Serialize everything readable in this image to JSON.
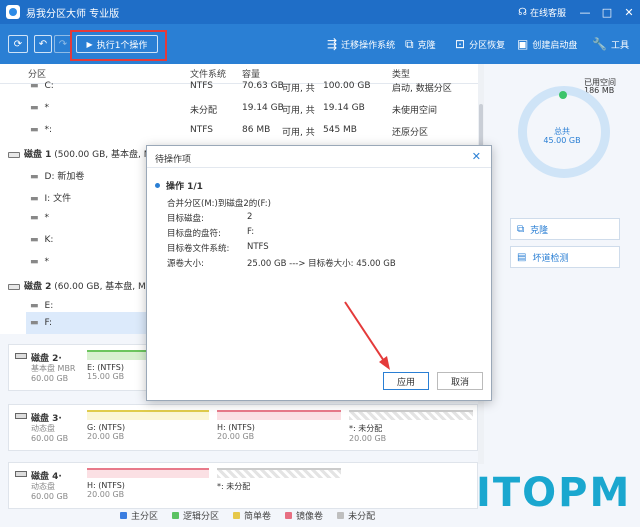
{
  "app": {
    "title": "易我分区大师 专业版"
  },
  "titlebar": {
    "service": "在线客服",
    "minimize": "—",
    "maximize": "□",
    "close": "✕"
  },
  "toolbar": {
    "execute_label": "执行1个操作",
    "items": [
      "迁移操作系统",
      "克隆",
      "分区恢复",
      "创建启动盘",
      "工具"
    ]
  },
  "list": {
    "headers": [
      "分区",
      "文件系统",
      "容量",
      "类型"
    ],
    "rows": [
      {
        "name": "C:",
        "fs": "NTFS",
        "used": "70.63 GB",
        "avail": "可用, 共",
        "total": "100.00 GB",
        "type": "启动, 数据分区"
      },
      {
        "name": "*",
        "fs": "未分配",
        "used": "19.14 GB",
        "avail": "可用, 共",
        "total": "19.14 GB",
        "type": "未使用空间"
      },
      {
        "name": "*:",
        "fs": "NTFS",
        "used": "86 MB",
        "avail": "可用, 共",
        "total": "545 MB",
        "type": "还原分区"
      },
      {
        "disk": "磁盘 1",
        "desc": "(500.00 GB, 基本盘, MBR..."
      },
      {
        "name": "D: 新加卷"
      },
      {
        "name": "I: 文件"
      },
      {
        "name": "*"
      },
      {
        "name": "K:"
      },
      {
        "name": "*"
      },
      {
        "disk": "磁盘 2",
        "desc": "(60.00 GB, 基本盘, MBR..."
      },
      {
        "name": "E:"
      },
      {
        "name": "F:"
      }
    ]
  },
  "maps": {
    "cards": [
      {
        "title": "磁盘 2·",
        "sub": "基本盘 MBR",
        "size": "60.00 GB",
        "segs": [
          {
            "t1": "E: (NTFS)",
            "t2": "15.00 GB"
          }
        ]
      },
      {
        "title": "磁盘 3·",
        "sub": "动态盘",
        "size": "60.00 GB",
        "segs": [
          {
            "t1": "G: (NTFS)",
            "t2": "20.00 GB"
          },
          {
            "t1": "H: (NTFS)",
            "t2": "20.00 GB"
          },
          {
            "t1": "*: 未分配",
            "t2": "20.00 GB"
          }
        ]
      },
      {
        "title": "磁盘 4·",
        "sub": "动态盘",
        "size": "60.00 GB",
        "segs": [
          {
            "t1": "H: (NTFS)",
            "t2": "20.00 GB"
          },
          {
            "t1": "*: 未分配",
            "t2": ""
          }
        ]
      }
    ]
  },
  "legend": [
    "主分区",
    "逻辑分区",
    "简单卷",
    "镜像卷",
    "未分配"
  ],
  "legend_colors": [
    "#3a7de0",
    "#5bc262",
    "#e6c84a",
    "#e76f82",
    "#bfbfbf"
  ],
  "right": {
    "used_label": "已用空间",
    "used_value": "186 MB",
    "total_label": "总共",
    "total_value": "45.00 GB",
    "clone": "克隆",
    "check": "坏道检测"
  },
  "watermark": "ITOPM",
  "modal": {
    "title": "待操作项",
    "close": "✕",
    "op_title": "操作 1/1",
    "op_desc": "合并分区(M:)到磁盘2的(F:)",
    "fields": [
      {
        "label": "目标磁盘:",
        "value": "2"
      },
      {
        "label": "目标盘的盘符:",
        "value": "F:"
      },
      {
        "label": "目标卷文件系统:",
        "value": "NTFS"
      },
      {
        "label": "源卷大小:",
        "value": "25.00 GB ---> 目标卷大小: 45.00 GB"
      }
    ],
    "apply": "应用",
    "cancel": "取消"
  }
}
